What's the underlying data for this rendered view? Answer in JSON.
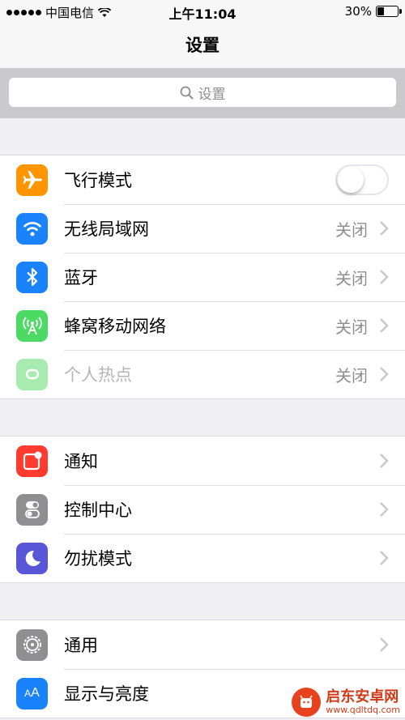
{
  "status_bar": {
    "carrier": "中国电信",
    "time": "上午11:04",
    "battery": "30%"
  },
  "nav": {
    "title": "设置"
  },
  "search": {
    "placeholder": "设置"
  },
  "group1": [
    {
      "icon": "airplane-icon",
      "color": "#ff9500",
      "label": "飞行模式",
      "toggle": false
    },
    {
      "icon": "wifi-icon",
      "color": "#1a82fb",
      "label": "无线局域网",
      "value": "关闭"
    },
    {
      "icon": "bluetooth-icon",
      "color": "#1a82fb",
      "label": "蓝牙",
      "value": "关闭"
    },
    {
      "icon": "cellular-icon",
      "color": "#4cd964",
      "label": "蜂窝移动网络",
      "value": "关闭"
    },
    {
      "icon": "hotspot-icon",
      "color": "#a7ebb0",
      "label": "个人热点",
      "value": "关闭",
      "disabled": true
    }
  ],
  "group2": [
    {
      "icon": "notifications-icon",
      "color": "#ff3b30",
      "label": "通知"
    },
    {
      "icon": "control-center-icon",
      "color": "#8e8e93",
      "label": "控制中心"
    },
    {
      "icon": "do-not-disturb-icon",
      "color": "#5856d6",
      "label": "勿扰模式"
    }
  ],
  "group3": [
    {
      "icon": "general-icon",
      "color": "#8e8e93",
      "label": "通用"
    },
    {
      "icon": "display-icon",
      "color": "#1a82fb",
      "label": "显示与亮度"
    }
  ],
  "watermark": {
    "title": "启东安卓网",
    "url": "www.qdltdq.com"
  }
}
